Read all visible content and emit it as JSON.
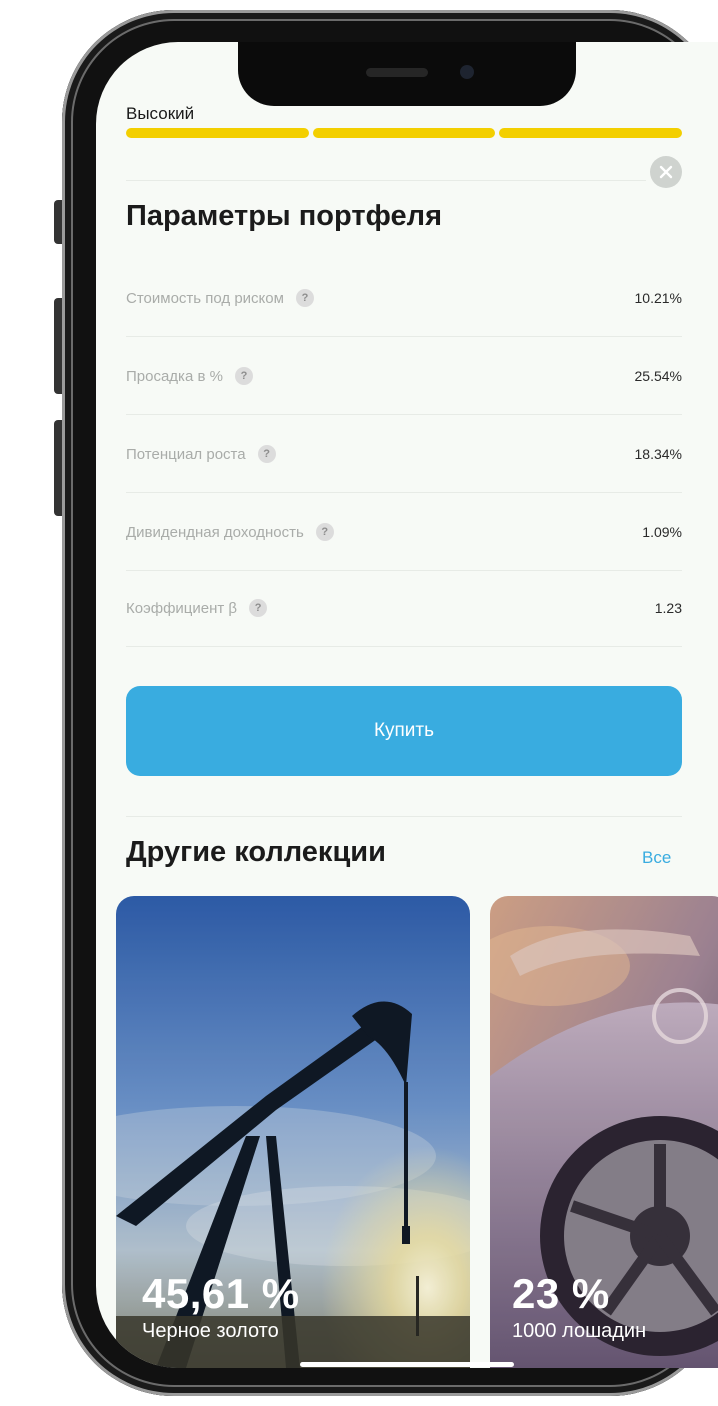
{
  "risk": {
    "label": "Высокий",
    "level_segments_filled": 3,
    "level_segments_total": 3,
    "color": "#f3cf00"
  },
  "close_icon": "close-icon",
  "portfolio": {
    "title": "Параметры портфеля",
    "params": [
      {
        "label": "Стоимость под риском",
        "value": "10.21%",
        "help": "?"
      },
      {
        "label": "Просадка в %",
        "value": "25.54%",
        "help": "?"
      },
      {
        "label": "Потенциал роста",
        "value": "18.34%",
        "help": "?"
      },
      {
        "label": "Дивидендная доходность",
        "value": "1.09%",
        "help": "?"
      },
      {
        "label": "Коэффициент β",
        "value": "1.23",
        "help": "?"
      }
    ]
  },
  "buy_button": {
    "label": "Купить",
    "color": "#39ace0"
  },
  "collections": {
    "title": "Другие коллекции",
    "all_link": "Все",
    "cards": [
      {
        "percent": "45,61 %",
        "name": "Черное золото",
        "image": "oil-pump-jack"
      },
      {
        "percent": "23 %",
        "name": "1000 лошадин",
        "image": "sports-car"
      }
    ]
  }
}
